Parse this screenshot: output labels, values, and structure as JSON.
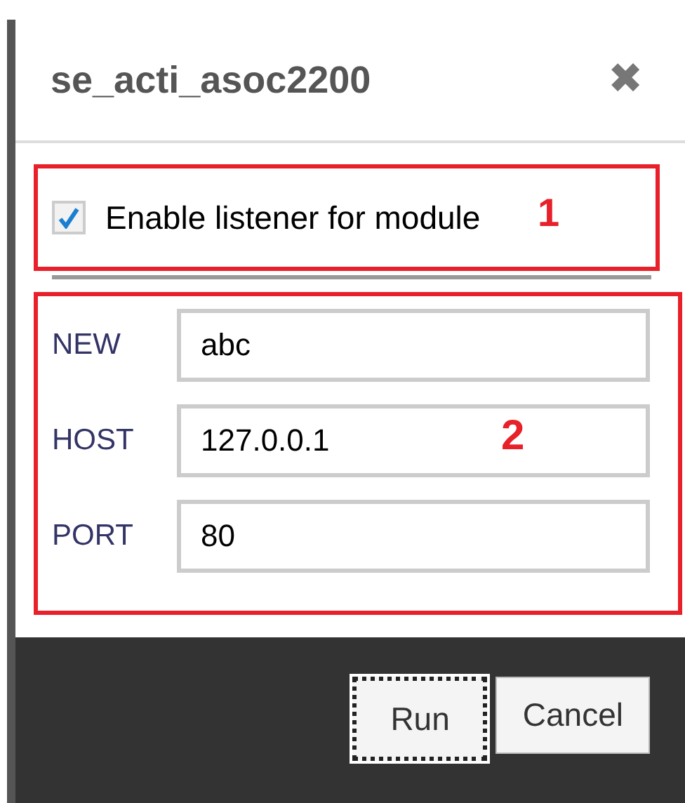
{
  "dialog": {
    "title": "se_acti_asoc2200",
    "close_icon": "✖"
  },
  "listener": {
    "label": "Enable listener for module",
    "checked": true
  },
  "fields": [
    {
      "label": "NEW",
      "value": "abc"
    },
    {
      "label": "HOST",
      "value": "127.0.0.1"
    },
    {
      "label": "PORT",
      "value": "80"
    }
  ],
  "buttons": [
    {
      "label": "Run",
      "focused": true
    },
    {
      "label": "Cancel",
      "focused": false
    }
  ],
  "annotations": [
    {
      "label": "1"
    },
    {
      "label": "2"
    }
  ]
}
